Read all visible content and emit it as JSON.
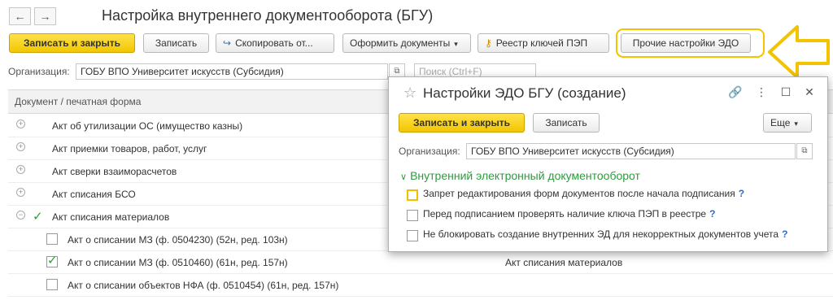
{
  "window": {
    "title": "Настройка внутреннего документооборота (БГУ)",
    "back_icon": "arrow-left",
    "forward_icon": "arrow-right"
  },
  "toolbar": {
    "save_close": "Записать и закрыть",
    "save": "Записать",
    "copy": "Скопировать от...",
    "make_docs": "Оформить документы",
    "keys_registry": "Реестр ключей ПЭП",
    "other_settings": "Прочие настройки ЭДО"
  },
  "org": {
    "label": "Организация:",
    "value": "ГОБУ ВПО Университет искусств (Субсидия)"
  },
  "search": {
    "placeholder": "Поиск (Ctrl+F)"
  },
  "table": {
    "header": "Документ / печатная форма",
    "rows": [
      {
        "label": "Акт об утилизации ОС (имущество казны)",
        "level": 0,
        "expander": "plus"
      },
      {
        "label": "Акт приемки товаров, работ, услуг",
        "level": 0,
        "expander": "plus"
      },
      {
        "label": "Акт сверки взаиморасчетов",
        "level": 0,
        "expander": "plus"
      },
      {
        "label": "Акт списания БСО",
        "level": 0,
        "expander": "plus"
      },
      {
        "label": "Акт списания материалов",
        "level": 0,
        "expander": "minus",
        "checked": true
      },
      {
        "label": "Акт о списании МЗ (ф. 0504230) (52н, ред. 103н)",
        "level": 1,
        "checked": false,
        "col2": ""
      },
      {
        "label": "Акт о списании МЗ (ф. 0510460) (61н, ред. 157н)",
        "level": 1,
        "checked": true,
        "col2": "Акт списания материалов"
      },
      {
        "label": "Акт о списании объектов НФА (ф. 0510454) (61н, ред. 157н)",
        "level": 1,
        "checked": false,
        "col2": ""
      }
    ]
  },
  "dialog": {
    "title": "Настройки ЭДО БГУ (создание)",
    "save_close": "Записать и закрыть",
    "save": "Записать",
    "more": "Еще",
    "org_label": "Организация:",
    "org_value": "ГОБУ ВПО Университет искусств (Субсидия)",
    "group_title": "Внутренний электронный документооборот",
    "options": [
      {
        "label": "Запрет редактирования форм документов после начала подписания",
        "checked": false,
        "help": "?"
      },
      {
        "label": "Перед подписанием проверять наличие ключа ПЭП в реестре",
        "checked": false,
        "help": "?"
      },
      {
        "label": "Не блокировать создание внутренних ЭД для некорректных документов учета",
        "checked": false,
        "help": "?"
      }
    ]
  },
  "colors": {
    "accent_yellow": "#f2c600",
    "highlight": "#f3c300",
    "group_green": "#2e9b3e",
    "check_green": "#2ca02c",
    "help_blue": "#2a6bcc"
  }
}
